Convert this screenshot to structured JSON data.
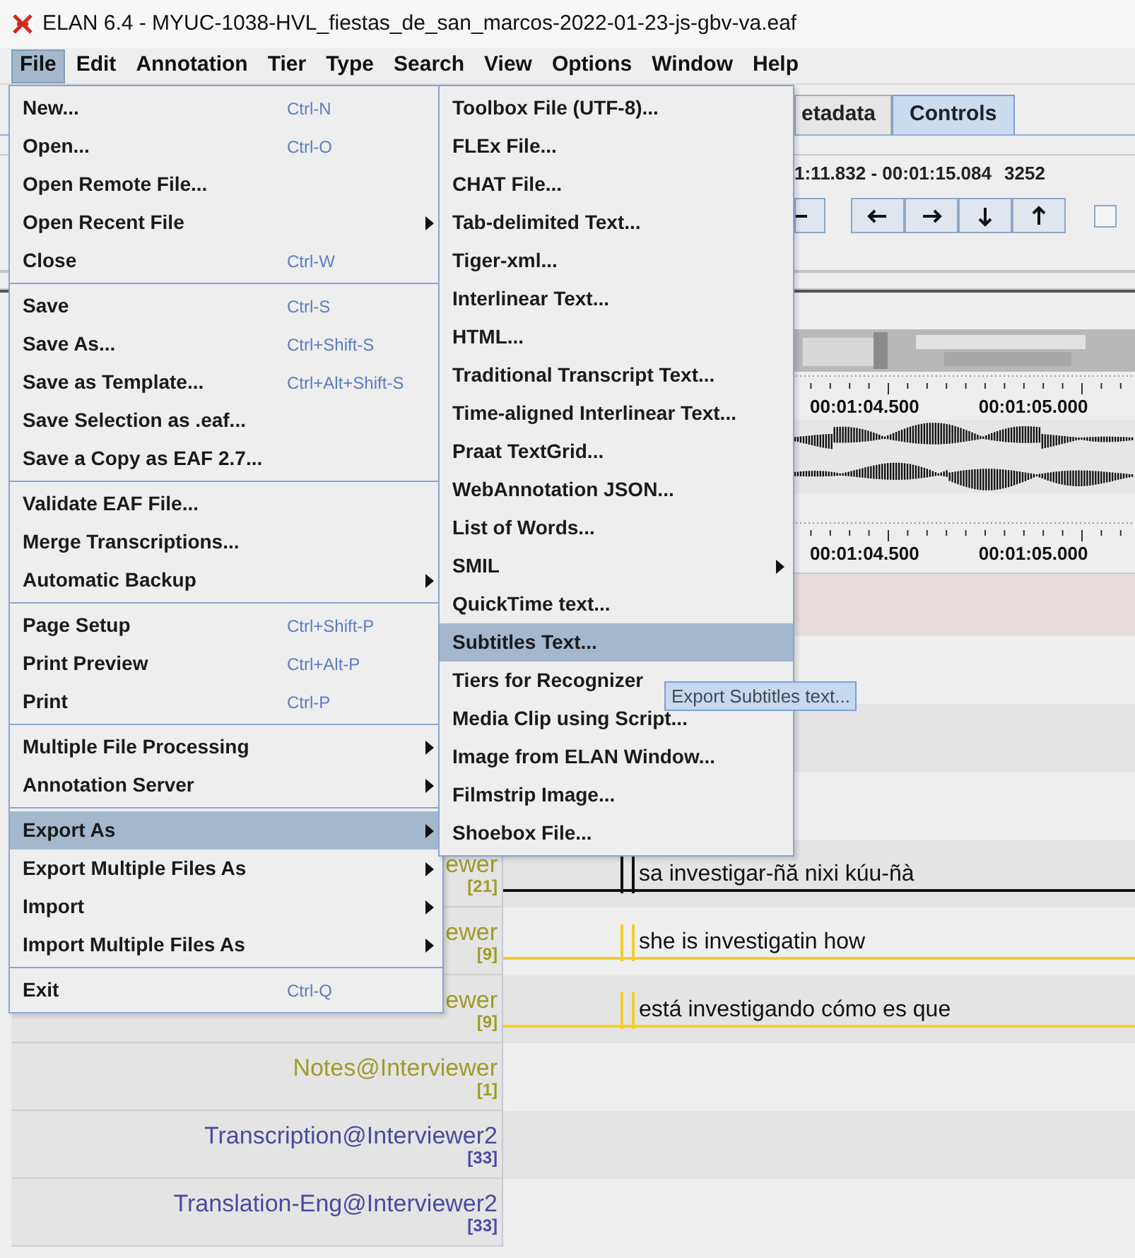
{
  "window": {
    "title": "ELAN 6.4 - MYUC-1038-HVL_fiestas_de_san_marcos-2022-01-23-js-gbv-va.eaf"
  },
  "menubar": [
    {
      "label": "File",
      "selected": true
    },
    {
      "label": "Edit",
      "selected": false
    },
    {
      "label": "Annotation",
      "selected": false
    },
    {
      "label": "Tier",
      "selected": false
    },
    {
      "label": "Type",
      "selected": false
    },
    {
      "label": "Search",
      "selected": false
    },
    {
      "label": "View",
      "selected": false
    },
    {
      "label": "Options",
      "selected": false
    },
    {
      "label": "Window",
      "selected": false
    },
    {
      "label": "Help",
      "selected": false
    }
  ],
  "file_menu": {
    "groups": [
      [
        {
          "label": "New...",
          "shortcut": "Ctrl-N",
          "submenu": false,
          "selected": false
        },
        {
          "label": "Open...",
          "shortcut": "Ctrl-O",
          "submenu": false,
          "selected": false
        },
        {
          "label": "Open Remote File...",
          "submenu": false,
          "selected": false
        },
        {
          "label": "Open Recent File",
          "submenu": true,
          "selected": false
        },
        {
          "label": "Close",
          "shortcut": "Ctrl-W",
          "submenu": false,
          "selected": false
        }
      ],
      [
        {
          "label": "Save",
          "shortcut": "Ctrl-S",
          "submenu": false,
          "selected": false
        },
        {
          "label": "Save As...",
          "shortcut": "Ctrl+Shift-S",
          "submenu": false,
          "selected": false
        },
        {
          "label": "Save as Template...",
          "shortcut": "Ctrl+Alt+Shift-S",
          "submenu": false,
          "selected": false
        },
        {
          "label": "Save Selection as .eaf...",
          "submenu": false,
          "selected": false
        },
        {
          "label": "Save a Copy as EAF 2.7...",
          "submenu": false,
          "selected": false
        }
      ],
      [
        {
          "label": "Validate EAF File...",
          "submenu": false,
          "selected": false
        },
        {
          "label": "Merge Transcriptions...",
          "submenu": false,
          "selected": false
        },
        {
          "label": "Automatic Backup",
          "submenu": true,
          "selected": false
        }
      ],
      [
        {
          "label": "Page Setup",
          "shortcut": "Ctrl+Shift-P",
          "submenu": false,
          "selected": false
        },
        {
          "label": "Print Preview",
          "shortcut": "Ctrl+Alt-P",
          "submenu": false,
          "selected": false
        },
        {
          "label": "Print",
          "shortcut": "Ctrl-P",
          "submenu": false,
          "selected": false
        }
      ],
      [
        {
          "label": "Multiple File Processing",
          "submenu": true,
          "selected": false
        },
        {
          "label": "Annotation Server",
          "submenu": true,
          "selected": false
        }
      ],
      [
        {
          "label": "Export As",
          "submenu": true,
          "selected": true
        },
        {
          "label": "Export Multiple Files As",
          "submenu": true,
          "selected": false
        },
        {
          "label": "Import",
          "submenu": true,
          "selected": false
        },
        {
          "label": "Import Multiple Files As",
          "submenu": true,
          "selected": false
        }
      ],
      [
        {
          "label": "Exit",
          "shortcut": "Ctrl-Q",
          "submenu": false,
          "selected": false
        }
      ]
    ]
  },
  "export_submenu": {
    "items": [
      {
        "label": "Toolbox File (UTF-8)...",
        "submenu": false,
        "selected": false
      },
      {
        "label": "FLEx File...",
        "submenu": false,
        "selected": false
      },
      {
        "label": "CHAT File...",
        "submenu": false,
        "selected": false
      },
      {
        "label": "Tab-delimited Text...",
        "submenu": false,
        "selected": false
      },
      {
        "label": "Tiger-xml...",
        "submenu": false,
        "selected": false
      },
      {
        "label": "Interlinear Text...",
        "submenu": false,
        "selected": false
      },
      {
        "label": "HTML...",
        "submenu": false,
        "selected": false
      },
      {
        "label": "Traditional Transcript Text...",
        "submenu": false,
        "selected": false
      },
      {
        "label": "Time-aligned Interlinear Text...",
        "submenu": false,
        "selected": false
      },
      {
        "label": "Praat TextGrid...",
        "submenu": false,
        "selected": false
      },
      {
        "label": "WebAnnotation JSON...",
        "submenu": false,
        "selected": false
      },
      {
        "label": "List of Words...",
        "submenu": false,
        "selected": false
      },
      {
        "label": "SMIL",
        "submenu": true,
        "selected": false
      },
      {
        "label": "QuickTime text...",
        "submenu": false,
        "selected": false
      },
      {
        "label": "Subtitles Text...",
        "submenu": false,
        "selected": true
      },
      {
        "label": "Tiers for Recognizer",
        "submenu": false,
        "selected": false
      },
      {
        "label": "Media Clip using Script...",
        "submenu": false,
        "selected": false
      },
      {
        "label": "Image from ELAN Window...",
        "submenu": false,
        "selected": false
      },
      {
        "label": "Filmstrip Image...",
        "submenu": false,
        "selected": false
      },
      {
        "label": "Shoebox File...",
        "submenu": false,
        "selected": false
      }
    ]
  },
  "tooltip": {
    "text": "Export Subtitles text..."
  },
  "viewer_tabs": [
    {
      "label": "etadata",
      "selected": false
    },
    {
      "label": "Controls",
      "selected": true
    }
  ],
  "selection": {
    "time_range": "1:11.832 - 00:01:15.084",
    "frames": "3252"
  },
  "controls": {
    "buttons": [
      {
        "kind": "cut"
      },
      {
        "kind": "left"
      },
      {
        "kind": "right"
      },
      {
        "kind": "down"
      },
      {
        "kind": "up"
      }
    ],
    "checkbox": {
      "checked": false
    }
  },
  "rulers": [
    {
      "labels": [
        "00:01:04.500",
        "00:01:05.000"
      ]
    },
    {
      "labels": [
        "00:01:04.500",
        "00:01:05.000"
      ]
    }
  ],
  "tiers": [
    {
      "label": "ewer",
      "count": "[21]",
      "color": "#9c9c2a",
      "line": {
        "color": "#111111"
      },
      "annotation": "sa investigar-ñă nixi kúu-ñà"
    },
    {
      "label": "ewer",
      "count": "[9]",
      "color": "#9c9c2a",
      "line": {
        "color": "#f5cc2a"
      },
      "annotation": "she is investigatin how"
    },
    {
      "label": "ewer",
      "count": "[9]",
      "color": "#9c9c2a",
      "line": {
        "color": "#f5cc2a"
      },
      "annotation": "está investigando cómo es que"
    },
    {
      "label": "Notes@Interviewer",
      "count": "[1]",
      "color": "#9c9c2a"
    },
    {
      "label": "Transcription@Interviewer2",
      "count": "[33]",
      "color": "#4a4aa0"
    },
    {
      "label": "Translation-Eng@Interviewer2",
      "count": "[33]",
      "color": "#4a4aa0"
    }
  ]
}
